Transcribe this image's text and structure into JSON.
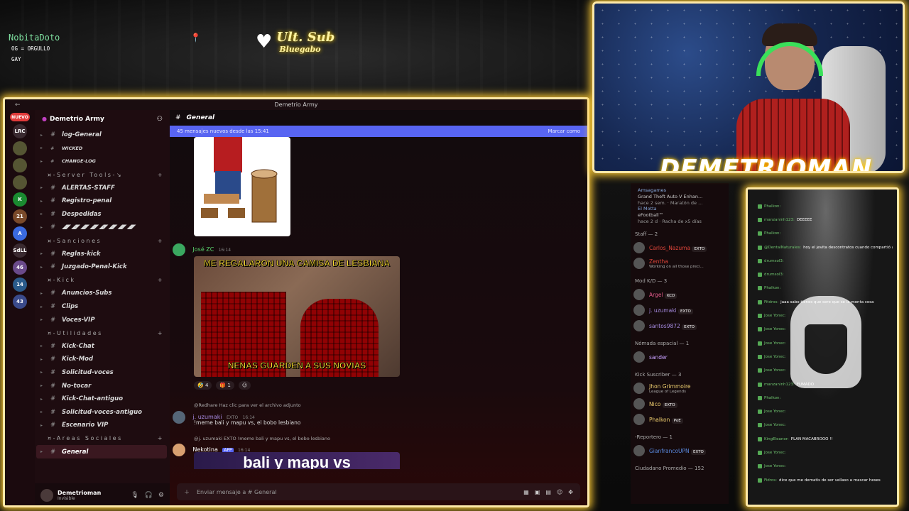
{
  "overlay": {
    "chat_user": "NobitaDoto",
    "chat_msg": "OG = ORGULLO GAY",
    "ultsub_title": "Ult. Sub",
    "ultsub_name": "Bluegabo",
    "streamer_name": "DEMETRIOMAN"
  },
  "discord": {
    "window_title": "Demetrio Army",
    "server_name": "Demetrio Army",
    "servers": [
      "NUEVO",
      "LRC",
      "K",
      "21",
      "A",
      "SdLL",
      "46",
      "14",
      "43"
    ],
    "channels": [
      {
        "type": "ch",
        "label": "log-General"
      },
      {
        "type": "ch",
        "label": "WICKED",
        "small": true
      },
      {
        "type": "ch",
        "label": "CHANGE-LOG",
        "small": true
      },
      {
        "type": "cat",
        "label": "¤-Server Tools-↘"
      },
      {
        "type": "ch",
        "label": "ALERTAS-STAFF"
      },
      {
        "type": "ch",
        "label": "Registro-penal"
      },
      {
        "type": "ch",
        "label": "Despedidas"
      },
      {
        "type": "ch",
        "label": "◢◤◢◤◢◤◢◤◢◤◢◤◢◤◢◤"
      },
      {
        "type": "cat",
        "label": "¤-Sanciones"
      },
      {
        "type": "ch",
        "label": "Reglas-kick"
      },
      {
        "type": "ch",
        "label": "Juzgado-Penal-Kick"
      },
      {
        "type": "cat",
        "label": "¤-Kick"
      },
      {
        "type": "ch",
        "label": "Anuncios-Subs"
      },
      {
        "type": "ch",
        "label": "Clips"
      },
      {
        "type": "ch",
        "label": "Voces-VIP"
      },
      {
        "type": "cat",
        "label": "¤-Utilidades"
      },
      {
        "type": "ch",
        "label": "Kick-Chat"
      },
      {
        "type": "ch",
        "label": "Kick-Mod"
      },
      {
        "type": "ch",
        "label": "Solicitud-voces"
      },
      {
        "type": "ch",
        "label": "No-tocar"
      },
      {
        "type": "ch",
        "label": "Kick-Chat-antiguo"
      },
      {
        "type": "ch",
        "label": "Solicitud-voces-antiguo"
      },
      {
        "type": "ch",
        "label": "Escenario VIP"
      },
      {
        "type": "cat",
        "label": "¤-Areas Sociales"
      },
      {
        "type": "ch",
        "label": "General",
        "active": true
      }
    ],
    "user": {
      "name": "Demetrioman",
      "status": "Invisible"
    },
    "channel_title": "General",
    "new_messages": "45 mensajes nuevos desde las 15:41",
    "mark_read": "Marcar como",
    "msg1": {
      "author": "José ZC",
      "time": "16:14"
    },
    "caption_top": "ME REGALARON UNA CAMISA DE LESBIANA",
    "caption_bottom": "NENAS GUARDEN A SUS NOVIAS",
    "reactions": [
      "🤣 4",
      "🎁 1",
      "☺"
    ],
    "reply_ref": "@Redhare Haz clic para ver el archivo adjunto",
    "msg2": {
      "author": "j. uzumaki",
      "tag": "EXTO",
      "time": "16:14",
      "text": "!meme bali y mapu vs, el bobo lesbiano"
    },
    "reply_ref2": "@j. uzumaki  EXTO  !meme bali y mapu vs, el bobo lesbiano",
    "msg3": {
      "author": "Nekotina",
      "badge": "APP",
      "time": "16:14"
    },
    "meme2_caption": "bali y mapu vs",
    "composer_placeholder": "Enviar mensaje a #  General",
    "members": {
      "activity": [
        {
          "who": "Amsagames",
          "title": "Grand Theft Auto V Enhan...",
          "meta": "hace 2 sem. · Maratón de ..."
        },
        {
          "who": "El Motta",
          "title": "eFootball™",
          "meta": "hace 2 d · Racha de x5 días"
        }
      ],
      "sections": [
        {
          "title": "Staff — 2",
          "items": [
            {
              "name": "Carlos_Nazuma",
              "tag": "EXTO",
              "color": "#e0453a"
            },
            {
              "name": "Zentha",
              "sub": "Working on all those preci...",
              "color": "#e0453a"
            }
          ]
        },
        {
          "title": "Mod K/D — 3",
          "items": [
            {
              "name": "Argel",
              "tag": "KCD",
              "color": "#e05a8a"
            },
            {
              "name": "j. uzumaki",
              "tag": "EXTO",
              "color": "#a58ae0"
            },
            {
              "name": "santos9872",
              "tag": "EXTO",
              "color": "#a58ae0"
            }
          ]
        },
        {
          "title": "Nómada espacial — 1",
          "items": [
            {
              "name": "sander",
              "color": "#c8a0ff"
            }
          ]
        },
        {
          "title": "Kick Suscriber — 3",
          "items": [
            {
              "name": "Jhon Grimmoire",
              "sub": "League of Legends",
              "color": "#f0d070"
            },
            {
              "name": "Nico",
              "tag": "EXTO",
              "color": "#f0d070"
            },
            {
              "name": "Phalkon",
              "tag": "PoE",
              "color": "#f0d070"
            }
          ]
        },
        {
          "title": "-Reportero — 1",
          "items": [
            {
              "name": "GianfrancoUPN",
              "tag": "EXTO",
              "color": "#5a8ae0"
            }
          ]
        },
        {
          "title": "Ciudadano Promedio — 152",
          "items": []
        }
      ]
    }
  },
  "kickchat": [
    {
      "n": "Phalkon:",
      "t": ""
    },
    {
      "n": "manzaninh123:",
      "t": "DEEEEE"
    },
    {
      "n": "Phalkon:",
      "t": ""
    },
    {
      "n": "@DentalNaturales:",
      "t": "hoy el jevita descontratos cuando compartió a los demás"
    },
    {
      "n": "drumsol3:",
      "t": ""
    },
    {
      "n": "drumsol3:",
      "t": ""
    },
    {
      "n": "Phalkon:",
      "t": ""
    },
    {
      "n": "Fitdros:",
      "t": "jaaa sabo tienes que sere que se la monta cosa"
    },
    {
      "n": "Jose Yonec:",
      "t": ""
    },
    {
      "n": "Jose Yonec:",
      "t": ""
    },
    {
      "n": "Jose Yonec:",
      "t": ""
    },
    {
      "n": "Jose Yonec:",
      "t": ""
    },
    {
      "n": "Jose Yonec:",
      "t": ""
    },
    {
      "n": "manzaninh123:",
      "t": "FUMADO"
    },
    {
      "n": "Phalkon:",
      "t": ""
    },
    {
      "n": "Jose Yonec:",
      "t": ""
    },
    {
      "n": "Jose Yonec:",
      "t": ""
    },
    {
      "n": "KingEleanor:",
      "t": "PLAN MACABROOO !!"
    },
    {
      "n": "Jose Yonec:",
      "t": ""
    },
    {
      "n": "Jose Yonec:",
      "t": ""
    },
    {
      "n": "Fidros:",
      "t": "dice que me dematis de ser vellaso a mascar heses"
    }
  ]
}
